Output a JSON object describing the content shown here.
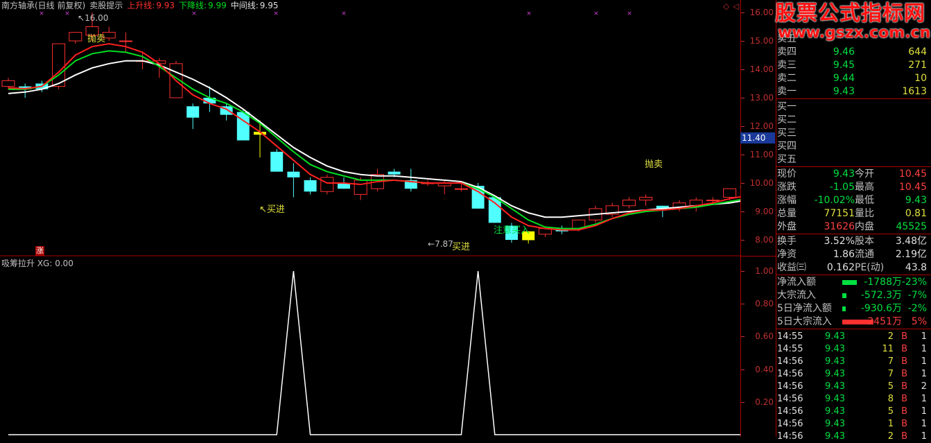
{
  "header": {
    "stock": "南方轴承(日线 前复权)",
    "indicator_name": "卖股提示",
    "up_label": "上升线:",
    "up_value": "9.93",
    "down_label": "下降线:",
    "down_value": "9.99",
    "mid_label": "中间线:",
    "mid_value": "9.95"
  },
  "annotations": {
    "high_label": "16.00",
    "sell1": "抛卖",
    "sell2": "抛卖",
    "buy1": "买进",
    "buy2": "买进",
    "low_label": "7.87",
    "attention": "注意买入",
    "limit_badge": "涨"
  },
  "indicator_header": "吸筹拉升 XG: 0.00",
  "price_axis": [
    "16.00",
    "15.00",
    "14.00",
    "13.00",
    "12.00",
    "11.00",
    "10.00",
    "9.00",
    "8.00"
  ],
  "indicator_axis": [
    "1.00",
    "0.80",
    "0.60",
    "0.40",
    "0.20"
  ],
  "cursor_value": "11.40",
  "watermark": {
    "line1": "股票公式指标网",
    "line2": "www.gszx.com.cn"
  },
  "order_book": {
    "sell": [
      {
        "label": "卖五",
        "price": "",
        "vol": ""
      },
      {
        "label": "卖四",
        "price": "9.46",
        "vol": "644"
      },
      {
        "label": "卖三",
        "price": "9.45",
        "vol": "271"
      },
      {
        "label": "卖二",
        "price": "9.44",
        "vol": "10"
      },
      {
        "label": "卖一",
        "price": "9.43",
        "vol": "1613"
      }
    ],
    "buy": [
      {
        "label": "买一"
      },
      {
        "label": "买二"
      },
      {
        "label": "买三"
      },
      {
        "label": "买四"
      },
      {
        "label": "买五"
      }
    ]
  },
  "quote": [
    {
      "l1": "现价",
      "v1": "9.43",
      "c1": "green",
      "l2": "今开",
      "v2": "10.45",
      "c2": "red"
    },
    {
      "l1": "涨跌",
      "v1": "-1.05",
      "c1": "green",
      "l2": "最高",
      "v2": "10.45",
      "c2": "red"
    },
    {
      "l1": "涨幅",
      "v1": "-10.02%",
      "c1": "green",
      "l2": "最低",
      "v2": "9.43",
      "c2": "green"
    },
    {
      "l1": "总量",
      "v1": "77151",
      "c1": "yellow",
      "l2": "量比",
      "v2": "0.81",
      "c2": "yellow"
    },
    {
      "l1": "外盘",
      "v1": "31626",
      "c1": "red",
      "l2": "内盘",
      "v2": "45525",
      "c2": "green"
    }
  ],
  "fundamentals": [
    {
      "l1": "换手",
      "v1": "3.52%",
      "l2": "股本",
      "v2": "3.48亿"
    },
    {
      "l1": "净资",
      "v1": "1.86",
      "l2": "流通",
      "v2": "2.19亿"
    },
    {
      "l1": "收益㈢",
      "v1": "0.162",
      "l2": "PE(动)",
      "v2": "43.8"
    }
  ],
  "flows": [
    {
      "label": "净流入额",
      "value": "-1788万",
      "pct": "-23%",
      "color": "green",
      "bar": 0.23
    },
    {
      "label": "大宗流入",
      "value": "-572.3万",
      "pct": "-7%",
      "color": "green",
      "bar": 0.07
    },
    {
      "label": "5日净流入额",
      "value": "-930.6万",
      "pct": "-2%",
      "color": "green",
      "bar": 0.02
    },
    {
      "label": "5日大宗流入",
      "value": "2451万",
      "pct": "5%",
      "color": "red",
      "bar": 0.5
    }
  ],
  "ticks": [
    {
      "time": "14:55",
      "price": "9.43",
      "vol": "2",
      "side": "B",
      "n": "1"
    },
    {
      "time": "14:55",
      "price": "9.43",
      "vol": "11",
      "side": "B",
      "n": "1"
    },
    {
      "time": "14:56",
      "price": "9.43",
      "vol": "7",
      "side": "B",
      "n": "1"
    },
    {
      "time": "14:56",
      "price": "9.43",
      "vol": "7",
      "side": "B",
      "n": "1"
    },
    {
      "time": "14:56",
      "price": "9.43",
      "vol": "5",
      "side": "B",
      "n": "2"
    },
    {
      "time": "14:56",
      "price": "9.43",
      "vol": "8",
      "side": "B",
      "n": "1"
    },
    {
      "time": "14:56",
      "price": "9.43",
      "vol": "5",
      "side": "B",
      "n": "1"
    },
    {
      "time": "14:56",
      "price": "9.43",
      "vol": "1",
      "side": "B",
      "n": "1"
    },
    {
      "time": "14:56",
      "price": "9.43",
      "vol": "2",
      "side": "B",
      "n": "1"
    }
  ],
  "candles": [
    [
      13.4,
      13.6,
      13.3,
      13.7
    ],
    [
      13.4,
      13.3,
      13.0,
      13.5
    ],
    [
      13.5,
      13.3,
      13.2,
      13.6
    ],
    [
      13.4,
      14.9,
      13.3,
      14.9
    ],
    [
      15.0,
      15.3,
      14.9,
      15.3
    ],
    [
      15.2,
      15.5,
      15.0,
      16.0
    ],
    [
      15.1,
      15.3,
      15.0,
      15.5
    ],
    [
      15.0,
      15.0,
      14.6,
      15.3
    ],
    [
      14.3,
      14.3,
      14.0,
      14.6
    ],
    [
      14.2,
      14.3,
      13.7,
      14.4
    ],
    [
      13.0,
      14.2,
      13.0,
      14.3
    ],
    [
      12.7,
      12.3,
      11.9,
      12.8
    ],
    [
      13.0,
      12.8,
      12.5,
      13.4
    ],
    [
      12.7,
      12.4,
      12.2,
      12.8
    ],
    [
      12.5,
      11.5,
      11.5,
      12.6
    ],
    [
      11.8,
      11.7,
      10.9,
      12.2
    ],
    [
      11.1,
      10.4,
      10.4,
      11.2
    ],
    [
      10.4,
      10.2,
      9.5,
      10.7
    ],
    [
      10.1,
      9.7,
      9.6,
      10.2
    ],
    [
      9.7,
      10.2,
      9.6,
      10.3
    ],
    [
      10.0,
      9.8,
      9.8,
      10.2
    ],
    [
      9.6,
      10.1,
      9.4,
      10.2
    ],
    [
      9.8,
      10.3,
      9.7,
      10.5
    ],
    [
      10.4,
      10.3,
      10.2,
      10.5
    ],
    [
      10.1,
      9.8,
      9.7,
      10.5
    ],
    [
      10.0,
      10.0,
      9.9,
      10.1
    ],
    [
      9.9,
      10.0,
      9.6,
      10.1
    ],
    [
      9.8,
      9.8,
      9.7,
      10.0
    ],
    [
      9.9,
      9.1,
      9.1,
      10.0
    ],
    [
      9.5,
      8.6,
      8.6,
      9.5
    ],
    [
      8.5,
      8.0,
      7.9,
      8.6
    ],
    [
      8.3,
      7.99,
      7.87,
      8.3
    ],
    [
      8.2,
      8.4,
      8.1,
      8.4
    ],
    [
      8.4,
      8.3,
      8.2,
      8.5
    ],
    [
      8.4,
      8.7,
      8.3,
      8.7
    ],
    [
      8.7,
      9.1,
      8.6,
      9.2
    ],
    [
      8.9,
      9.2,
      8.8,
      9.3
    ],
    [
      9.2,
      9.4,
      9.1,
      9.5
    ],
    [
      9.4,
      9.5,
      9.2,
      9.6
    ],
    [
      9.2,
      9.1,
      8.8,
      9.2
    ],
    [
      9.1,
      9.3,
      9.0,
      9.4
    ],
    [
      9.2,
      9.4,
      9.0,
      9.5
    ],
    [
      9.4,
      9.4,
      9.3,
      9.5
    ],
    [
      9.5,
      9.8,
      9.4,
      9.8
    ],
    [
      9.9,
      9.8,
      9.7,
      10.1
    ],
    [
      9.5,
      9.9,
      9.4,
      9.9
    ],
    [
      10.2,
      10.8,
      10.1,
      10.9
    ],
    [
      10.5,
      10.8,
      10.4,
      11.0
    ],
    [
      10.5,
      10.4,
      10.3,
      10.6
    ],
    [
      10.1,
      10.4,
      10.0,
      10.5
    ],
    [
      10.45,
      9.43,
      9.43,
      10.45
    ]
  ],
  "lines": {
    "red": [
      13.35,
      13.32,
      13.4,
      13.9,
      14.5,
      14.8,
      14.9,
      14.8,
      14.6,
      14.2,
      13.6,
      13.1,
      12.8,
      12.6,
      12.2,
      11.8,
      11.3,
      10.8,
      10.3,
      10.0,
      10.0,
      9.95,
      10.05,
      10.1,
      10.05,
      10.0,
      10.0,
      10.0,
      9.7,
      9.3,
      8.8,
      8.5,
      8.4,
      8.35,
      8.35,
      8.5,
      8.75,
      8.95,
      9.05,
      9.05,
      9.1,
      9.2,
      9.3,
      9.45,
      9.55,
      9.7,
      10.0,
      10.3,
      10.4,
      10.35,
      9.95
    ],
    "green": [
      13.3,
      13.3,
      13.4,
      13.8,
      14.3,
      14.55,
      14.65,
      14.6,
      14.45,
      14.1,
      13.7,
      13.3,
      13.0,
      12.8,
      12.5,
      12.1,
      11.6,
      11.1,
      10.65,
      10.4,
      10.25,
      10.1,
      10.1,
      10.1,
      10.05,
      10.0,
      10.0,
      10.0,
      9.8,
      9.5,
      9.1,
      8.7,
      8.45,
      8.4,
      8.4,
      8.55,
      8.75,
      8.9,
      9.0,
      9.05,
      9.1,
      9.15,
      9.25,
      9.35,
      9.45,
      9.55,
      9.8,
      10.05,
      10.15,
      10.2,
      9.95
    ],
    "white": [
      13.15,
      13.2,
      13.3,
      13.5,
      13.8,
      14.05,
      14.2,
      14.3,
      14.3,
      14.15,
      13.9,
      13.65,
      13.35,
      13.0,
      12.6,
      12.15,
      11.7,
      11.25,
      10.9,
      10.6,
      10.4,
      10.3,
      10.25,
      10.25,
      10.2,
      10.15,
      10.1,
      10.05,
      9.85,
      9.55,
      9.2,
      8.95,
      8.8,
      8.8,
      8.85,
      8.9,
      8.95,
      9.0,
      9.05,
      9.1,
      9.15,
      9.2,
      9.25,
      9.3,
      9.4,
      9.5,
      9.65,
      9.8,
      9.95,
      10.0,
      9.95
    ]
  },
  "indicator_signal": [
    0,
    0,
    0,
    0,
    0,
    0,
    0,
    0,
    0,
    0,
    0,
    0,
    0,
    0,
    0,
    0,
    0,
    1,
    0,
    0,
    0,
    0,
    0,
    0,
    0,
    0,
    0,
    0,
    1,
    0,
    0,
    0,
    0,
    0,
    0,
    0,
    0,
    0,
    0,
    0,
    0,
    0,
    0,
    0,
    0,
    0,
    0,
    0,
    0,
    0,
    0
  ],
  "colors": {
    "up": "#ff3030",
    "down": "#50ffff",
    "axis": "#c03030",
    "red_line": "#ff2020",
    "green_line": "#00e020",
    "white_line": "#ffffff"
  }
}
